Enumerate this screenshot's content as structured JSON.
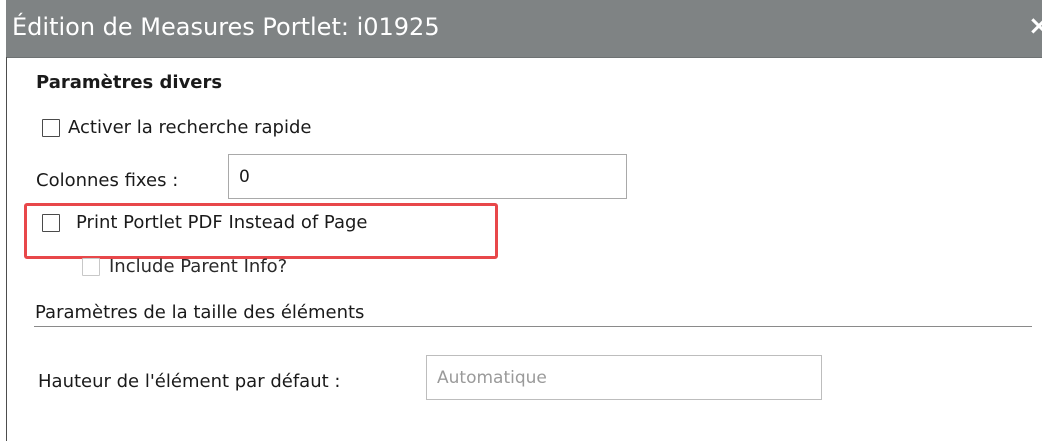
{
  "dialog": {
    "title": "Édition de Measures Portlet: i01925",
    "close_glyph": "×",
    "close_icon": "close-icon"
  },
  "misc": {
    "section_title": "Paramètres divers",
    "quick_search_label": "Activer la recherche rapide",
    "quick_search_checked": false,
    "fixed_columns_label": "Colonnes fixes :",
    "fixed_columns_value": "0",
    "print_pdf_label": "Print Portlet PDF Instead of Page",
    "print_pdf_checked": false,
    "include_parent_label": "Include Parent Info?",
    "include_parent_checked": false,
    "include_parent_disabled": true
  },
  "size": {
    "section_title": "Paramètres de la taille des éléments",
    "height_label": "Hauteur de l'élément par défaut :",
    "height_placeholder": "Automatique"
  },
  "colors": {
    "titlebar": "#7f8384",
    "highlight": "#e8474a"
  }
}
